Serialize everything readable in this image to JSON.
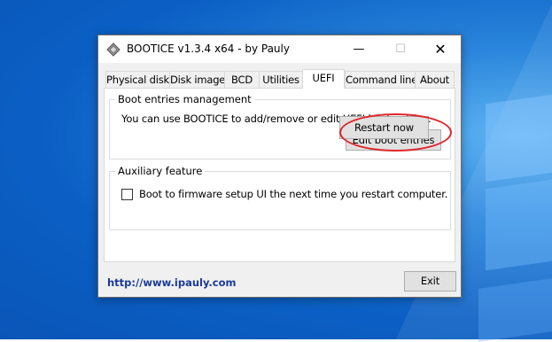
{
  "window": {
    "title": "BOOTICE v1.3.4 x64 - by Pauly",
    "app_icon": "bootice-app-icon",
    "controls": {
      "minimize": "—",
      "maximize": "☐",
      "close": "✕"
    }
  },
  "tabs": [
    {
      "label": "Physical disk",
      "active": false
    },
    {
      "label": "Disk image",
      "active": false
    },
    {
      "label": "BCD",
      "active": false
    },
    {
      "label": "Utilities",
      "active": false
    },
    {
      "label": "UEFI",
      "active": true
    },
    {
      "label": "Command line",
      "active": false
    },
    {
      "label": "About",
      "active": false
    }
  ],
  "boot_entries": {
    "legend": "Boot entries management",
    "description": "You can use BOOTICE to add/remove or edit UEFI boot entries.",
    "button_label": "Edit boot entries"
  },
  "auxiliary": {
    "legend": "Auxiliary feature",
    "checkbox_label": "Boot to firmware setup UI the next time you restart computer.",
    "checkbox_checked": false,
    "button_label": "Restart now"
  },
  "footer": {
    "link_text": "http://www.ipauly.com",
    "exit_label": "Exit"
  },
  "colors": {
    "highlight": "#e0262b",
    "link": "#1a3a9a",
    "desktop": "#0b5fc4"
  }
}
